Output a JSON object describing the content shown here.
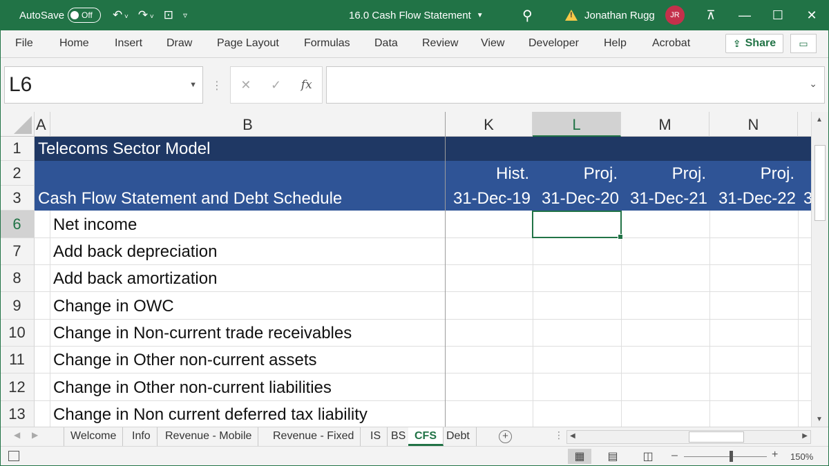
{
  "titlebar": {
    "autosave_label": "AutoSave",
    "autosave_state": "Off",
    "doc_title": "16.0 Cash Flow Statement",
    "user_name": "Jonathan Rugg",
    "user_initials": "JR",
    "bg_color": "#217346"
  },
  "ribbon": {
    "tabs": [
      "File",
      "Home",
      "Insert",
      "Draw",
      "Page Layout",
      "Formulas",
      "Data",
      "Review",
      "View",
      "Developer",
      "Help",
      "Acrobat"
    ],
    "share_label": "Share"
  },
  "formula_bar": {
    "name_box": "L6",
    "fx_label": "fx",
    "formula": ""
  },
  "grid": {
    "columns": [
      "A",
      "B",
      "K",
      "L",
      "M",
      "N"
    ],
    "selected_column": "L",
    "rows": [
      "1",
      "2",
      "3",
      "6",
      "7",
      "8",
      "9",
      "10",
      "11",
      "12",
      "13"
    ],
    "selected_row": "6",
    "title": "Telecoms Sector Model",
    "subtitle": "Cash Flow Statement and Debt Schedule",
    "period_types": [
      "Hist.",
      "Proj.",
      "Proj.",
      "Proj."
    ],
    "period_dates": [
      "31-Dec-19",
      "31-Dec-20",
      "31-Dec-21",
      "31-Dec-22"
    ],
    "overflow_char": "3",
    "line_items": [
      "Net income",
      "Add back depreciation",
      "Add back amortization",
      "Change in OWC",
      "Change in Non-current trade receivables",
      "Change in Other non-current assets",
      "Change in Other non-current liabilities",
      "Change in Non current deferred tax liability"
    ],
    "band_dark": "#1f3864",
    "band_medium": "#2f5496"
  },
  "sheets": {
    "tabs": [
      "Welcome",
      "Info",
      "Revenue - Mobile",
      "Revenue - Fixed",
      "IS",
      "BS",
      "CFS",
      "Debt"
    ],
    "active": "CFS"
  },
  "statusbar": {
    "zoom": "150%"
  }
}
